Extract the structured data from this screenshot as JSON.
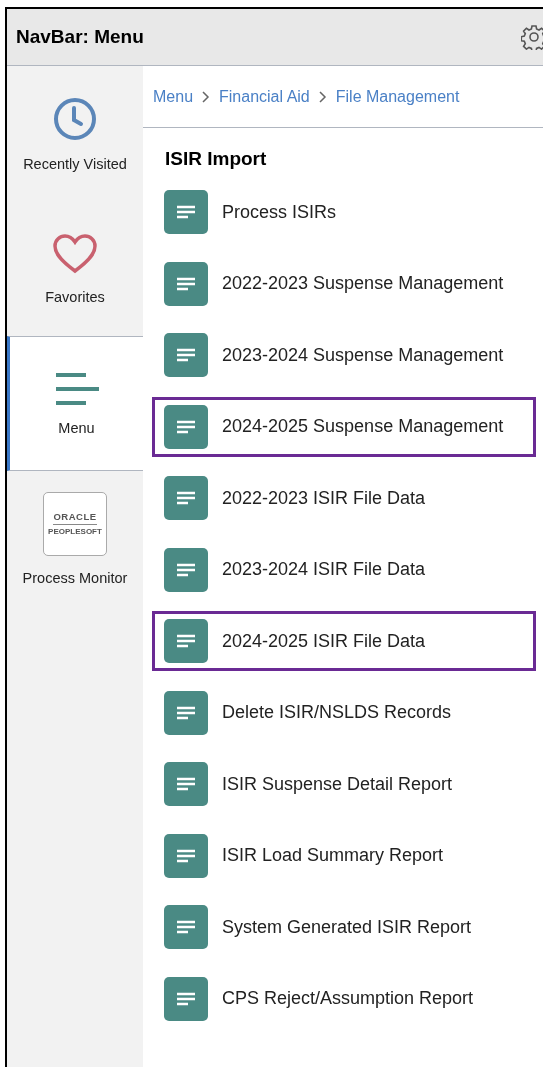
{
  "header": {
    "title": "NavBar: Menu"
  },
  "sidebar": {
    "items": [
      {
        "label": "Recently Visited",
        "kind": "clock",
        "selected": false
      },
      {
        "label": "Favorites",
        "kind": "heart",
        "selected": false
      },
      {
        "label": "Menu",
        "kind": "menu",
        "selected": true
      },
      {
        "label": "Process Monitor",
        "kind": "logo",
        "logo_lines": [
          "ORACLE",
          "PEOPLESOFT"
        ],
        "selected": false
      }
    ]
  },
  "breadcrumb": [
    "Menu",
    "Financial Aid",
    "File Management"
  ],
  "section_title": "ISIR Import",
  "items": [
    {
      "label": "Process ISIRs",
      "highlighted": false
    },
    {
      "label": "2022-2023 Suspense Management",
      "highlighted": false
    },
    {
      "label": "2023-2024 Suspense Management",
      "highlighted": false
    },
    {
      "label": "2024-2025 Suspense Management",
      "highlighted": true
    },
    {
      "label": "2022-2023 ISIR File Data",
      "highlighted": false
    },
    {
      "label": "2023-2024 ISIR File Data",
      "highlighted": false
    },
    {
      "label": "2024-2025 ISIR File Data",
      "highlighted": true
    },
    {
      "label": "Delete ISIR/NSLDS Records",
      "highlighted": false
    },
    {
      "label": "ISIR Suspense Detail Report",
      "highlighted": false
    },
    {
      "label": "ISIR Load Summary Report",
      "highlighted": false
    },
    {
      "label": "System Generated ISIR Report",
      "highlighted": false
    },
    {
      "label": "CPS Reject/Assumption Report",
      "highlighted": false
    }
  ]
}
